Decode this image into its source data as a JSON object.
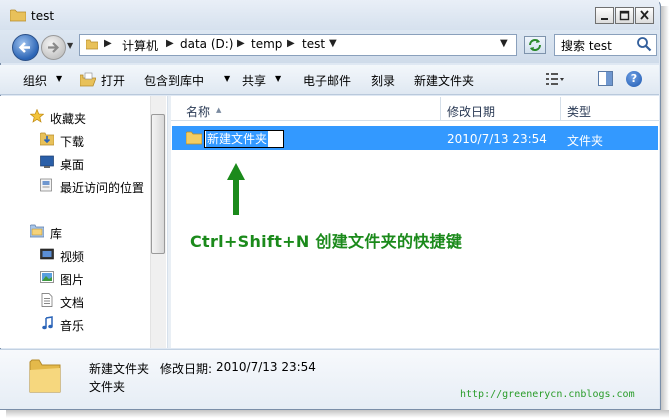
{
  "window": {
    "title": "test"
  },
  "address": {
    "crumbs": [
      "计算机",
      "data (D:)",
      "temp",
      "test"
    ]
  },
  "search": {
    "placeholder": "搜索 test"
  },
  "toolbar": {
    "organize": "组织",
    "open": "打开",
    "include_in_library": "包含到库中",
    "share": "共享",
    "email": "电子邮件",
    "burn": "刻录",
    "new_folder": "新建文件夹",
    "help": "?"
  },
  "nav": {
    "favorites": {
      "label": "收藏夹",
      "items": [
        "下载",
        "桌面",
        "最近访问的位置"
      ]
    },
    "libraries": {
      "label": "库",
      "items": [
        "视频",
        "图片",
        "文档",
        "音乐"
      ]
    }
  },
  "columns": {
    "name": "名称",
    "date": "修改日期",
    "type": "类型"
  },
  "file": {
    "name": "新建文件夹",
    "date": "2010/7/13 23:54",
    "type": "文件夹"
  },
  "annotation": {
    "text": "Ctrl+Shift+N  创建文件夹的快捷键"
  },
  "details": {
    "name": "新建文件夹",
    "date_label": "修改日期:",
    "date_value": "2010/7/13 23:54",
    "type": "文件夹"
  },
  "watermark": "http://greenerycn.cnblogs.com",
  "colors": {
    "accent": "#3399ff",
    "annotation": "#1b8a1b",
    "watermark": "#2a9c2a"
  }
}
